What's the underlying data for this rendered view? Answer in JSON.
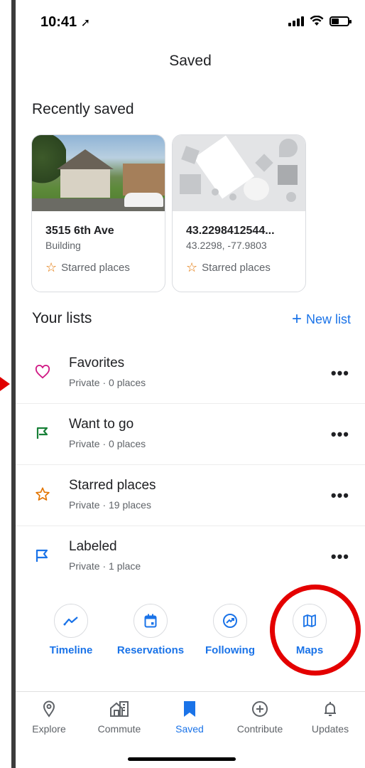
{
  "status": {
    "time": "10:41",
    "location_icon": "location-arrow-icon",
    "battery_level": 0.45
  },
  "header": {
    "title": "Saved"
  },
  "recent": {
    "title": "Recently saved",
    "cards": [
      {
        "title": "3515 6th Ave",
        "subtitle": "Building",
        "list": "Starred places"
      },
      {
        "title": "43.2298412544...",
        "subtitle": "43.2298, -77.9803",
        "list": "Starred places"
      }
    ]
  },
  "lists": {
    "title": "Your lists",
    "new_list_label": "New list",
    "items": [
      {
        "name": "Favorites",
        "meta": "Private · 0 places",
        "icon": "heart-icon",
        "color": "#d01884"
      },
      {
        "name": "Want to go",
        "meta": "Private · 0 places",
        "icon": "flag-icon",
        "color": "#188038"
      },
      {
        "name": "Starred places",
        "meta": "Private · 19 places",
        "icon": "star-icon",
        "color": "#e37400"
      },
      {
        "name": "Labeled",
        "meta": "Private · 1 place",
        "icon": "label-flag-icon",
        "color": "#1a73e8"
      }
    ],
    "more_label": "•••"
  },
  "shortcuts": [
    {
      "label": "Timeline",
      "icon": "timeline-icon"
    },
    {
      "label": "Reservations",
      "icon": "calendar-icon"
    },
    {
      "label": "Following",
      "icon": "following-icon"
    },
    {
      "label": "Maps",
      "icon": "map-icon"
    }
  ],
  "nav": {
    "items": [
      {
        "label": "Explore",
        "icon": "pin-icon"
      },
      {
        "label": "Commute",
        "icon": "commute-icon"
      },
      {
        "label": "Saved",
        "icon": "bookmark-icon"
      },
      {
        "label": "Contribute",
        "icon": "add-circle-icon"
      },
      {
        "label": "Updates",
        "icon": "bell-icon"
      }
    ]
  },
  "colors": {
    "accent": "#1a73e8",
    "annotation": "#e40000"
  }
}
